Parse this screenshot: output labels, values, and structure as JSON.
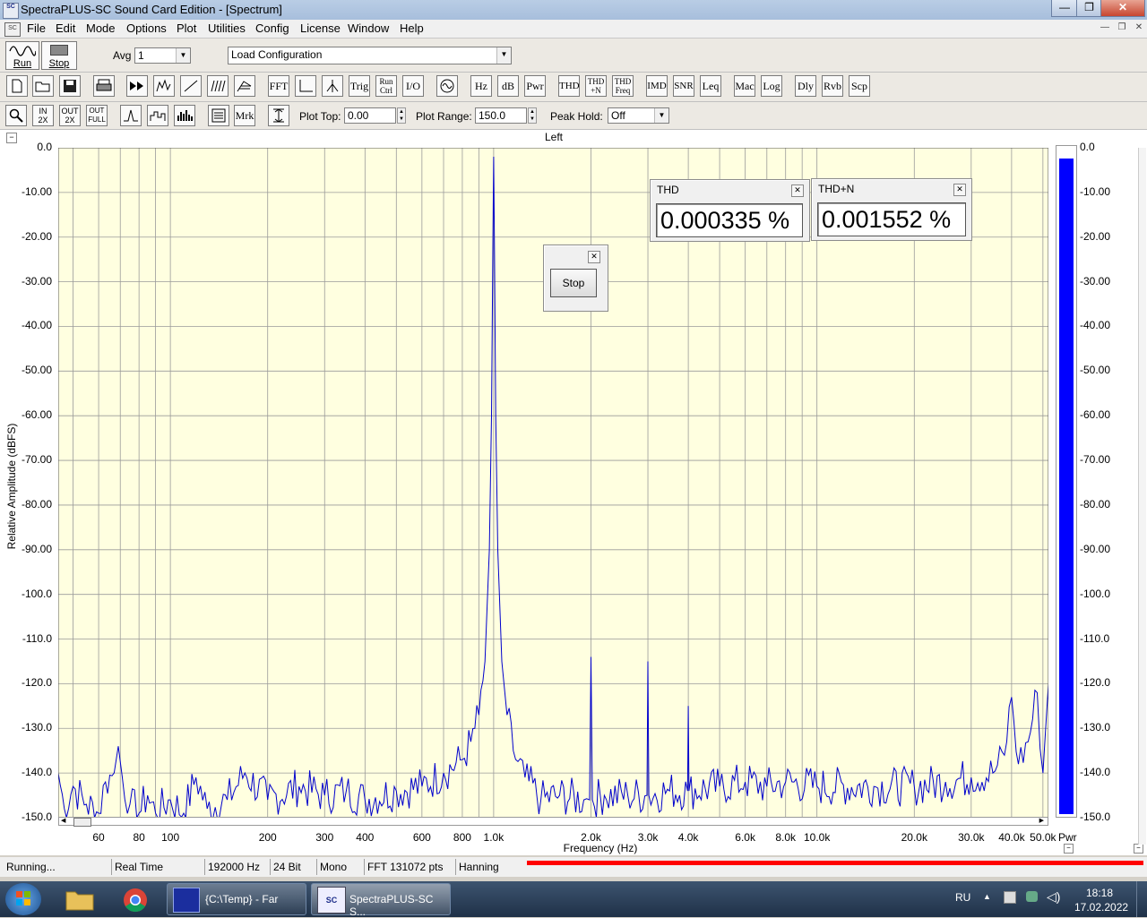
{
  "window": {
    "title": "SpectraPLUS-SC Sound Card Edition - [Spectrum]",
    "app_icon_text": "SC",
    "controls": {
      "minimize": "—",
      "restore": "❐",
      "close": "✕"
    }
  },
  "menu": {
    "items": [
      "File",
      "Edit",
      "Mode",
      "Options",
      "Plot",
      "Utilities",
      "Config",
      "License",
      "Window",
      "Help"
    ],
    "mdi_controls": [
      "—",
      "❐",
      "✕"
    ]
  },
  "toolbar1": {
    "run_label": "Run",
    "stop_label": "Stop",
    "avg_label": "Avg",
    "avg_value": "1",
    "config_value": "Load Configuration"
  },
  "toolbar2": {
    "text_buttons": [
      "FFT",
      "Trig",
      "Run Ctrl",
      "I/O",
      "Hz",
      "dB",
      "Pwr",
      "THD",
      "THD +N",
      "THD Freq",
      "IMD",
      "SNR",
      "Leq",
      "Mac",
      "Log",
      "Dly",
      "Rvb",
      "Scp"
    ]
  },
  "toolbar3": {
    "zoom_buttons": [
      "IN 2X",
      "OUT 2X",
      "OUT FULL"
    ],
    "mrk_label": "Mrk",
    "plot_top_label": "Plot Top:",
    "plot_top_value": "0.00",
    "plot_range_label": "Plot Range:",
    "plot_range_value": "150.0",
    "peak_hold_label": "Peak Hold:",
    "peak_hold_value": "Off"
  },
  "plot": {
    "channel_title": "Left",
    "power_label": "Pwr",
    "power_bar_color": "#0000ff",
    "trace_color": "#0000cc",
    "bg_color": "#ffffe0"
  },
  "chart_data": {
    "type": "line",
    "title": "Left",
    "xlabel": "Frequency (Hz)",
    "ylabel": "Relative Amplitude (dBFS)",
    "x_scale": "log",
    "xlim": [
      45,
      52000
    ],
    "ylim": [
      -150,
      0
    ],
    "grid": true,
    "y_ticks": [
      "0.0",
      "-10.00",
      "-20.00",
      "-30.00",
      "-40.00",
      "-50.00",
      "-60.00",
      "-70.00",
      "-80.00",
      "-90.00",
      "-100.0",
      "-110.0",
      "-120.0",
      "-130.0",
      "-140.0",
      "-150.0"
    ],
    "right_ticks": [
      "0.0",
      "-10.00",
      "-20.00",
      "-30.00",
      "-40.00",
      "-50.00",
      "-60.00",
      "-70.00",
      "-80.00",
      "-90.00",
      "-100.0",
      "-110.0",
      "-120.0",
      "-130.0",
      "-140.0",
      "-150.0"
    ],
    "x_ticks": [
      {
        "v": 60,
        "t": "60"
      },
      {
        "v": 80,
        "t": "80"
      },
      {
        "v": 100,
        "t": "100"
      },
      {
        "v": 200,
        "t": "200"
      },
      {
        "v": 300,
        "t": "300"
      },
      {
        "v": 400,
        "t": "400"
      },
      {
        "v": 600,
        "t": "600"
      },
      {
        "v": 800,
        "t": "800"
      },
      {
        "v": 1000,
        "t": "1.0k"
      },
      {
        "v": 2000,
        "t": "2.0k"
      },
      {
        "v": 3000,
        "t": "3.0k"
      },
      {
        "v": 4000,
        "t": "4.0k"
      },
      {
        "v": 6000,
        "t": "6.0k"
      },
      {
        "v": 8000,
        "t": "8.0k"
      },
      {
        "v": 10000,
        "t": "10.0k"
      },
      {
        "v": 20000,
        "t": "20.0k"
      },
      {
        "v": 30000,
        "t": "30.0k"
      },
      {
        "v": 40000,
        "t": "40.0k"
      },
      {
        "v": 50000,
        "t": "50.0k"
      }
    ],
    "series": [
      {
        "values": [
          [
            45,
            -140
          ],
          [
            47,
            -148
          ],
          [
            50,
            -143
          ],
          [
            55,
            -147
          ],
          [
            60,
            -149
          ],
          [
            63,
            -142
          ],
          [
            67,
            -140
          ],
          [
            69,
            -134
          ],
          [
            71,
            -141
          ],
          [
            75,
            -147
          ],
          [
            80,
            -149
          ],
          [
            85,
            -145
          ],
          [
            90,
            -149
          ],
          [
            100,
            -146
          ],
          [
            110,
            -149
          ],
          [
            120,
            -141
          ],
          [
            130,
            -148
          ],
          [
            150,
            -146
          ],
          [
            170,
            -140
          ],
          [
            200,
            -146
          ],
          [
            250,
            -143
          ],
          [
            300,
            -145
          ],
          [
            350,
            -144
          ],
          [
            400,
            -146
          ],
          [
            500,
            -144
          ],
          [
            600,
            -143
          ],
          [
            700,
            -140
          ],
          [
            800,
            -137
          ],
          [
            850,
            -133
          ],
          [
            900,
            -127
          ],
          [
            940,
            -115
          ],
          [
            970,
            -90
          ],
          [
            985,
            -60
          ],
          [
            995,
            -20
          ],
          [
            1000,
            -2
          ],
          [
            1005,
            -20
          ],
          [
            1015,
            -60
          ],
          [
            1030,
            -90
          ],
          [
            1060,
            -115
          ],
          [
            1100,
            -127
          ],
          [
            1150,
            -135
          ],
          [
            1250,
            -141
          ],
          [
            1400,
            -146
          ],
          [
            1600,
            -145
          ],
          [
            1900,
            -146
          ],
          [
            1980,
            -146
          ],
          [
            2000,
            -114
          ],
          [
            2020,
            -146
          ],
          [
            2200,
            -145
          ],
          [
            2600,
            -145
          ],
          [
            2980,
            -145
          ],
          [
            3000,
            -115
          ],
          [
            3020,
            -145
          ],
          [
            3500,
            -144
          ],
          [
            3980,
            -144
          ],
          [
            4000,
            -125
          ],
          [
            4020,
            -144
          ],
          [
            5000,
            -143
          ],
          [
            6000,
            -142
          ],
          [
            7000,
            -143
          ],
          [
            8000,
            -142
          ],
          [
            10000,
            -143
          ],
          [
            15000,
            -143
          ],
          [
            20000,
            -143
          ],
          [
            25000,
            -142
          ],
          [
            30000,
            -141
          ],
          [
            35000,
            -140
          ],
          [
            38000,
            -136
          ],
          [
            40000,
            -123
          ],
          [
            42000,
            -138
          ],
          [
            45000,
            -133
          ],
          [
            48000,
            -122
          ],
          [
            50000,
            -140
          ],
          [
            52000,
            -120
          ]
        ]
      }
    ],
    "power_level_db": -1.5
  },
  "meters": {
    "thd": {
      "title": "THD",
      "value": "0.000335 %"
    },
    "thdn": {
      "title": "THD+N",
      "value": "0.001552 %"
    },
    "stop_popup": {
      "button": "Stop"
    },
    "close_glyph": "✕"
  },
  "statusbar": {
    "items": [
      "Running...",
      "Real Time",
      "192000 Hz",
      "24 Bit",
      "Mono",
      "FFT 131072 pts",
      "Hanning"
    ],
    "progress_color": "#ff0000"
  },
  "taskbar": {
    "apps": [
      {
        "label": "{C:\\Temp} - Far"
      },
      {
        "label": "SpectraPLUS-SC S..."
      }
    ],
    "lang": "RU",
    "time": "18:18",
    "date": "17.02.2022"
  }
}
